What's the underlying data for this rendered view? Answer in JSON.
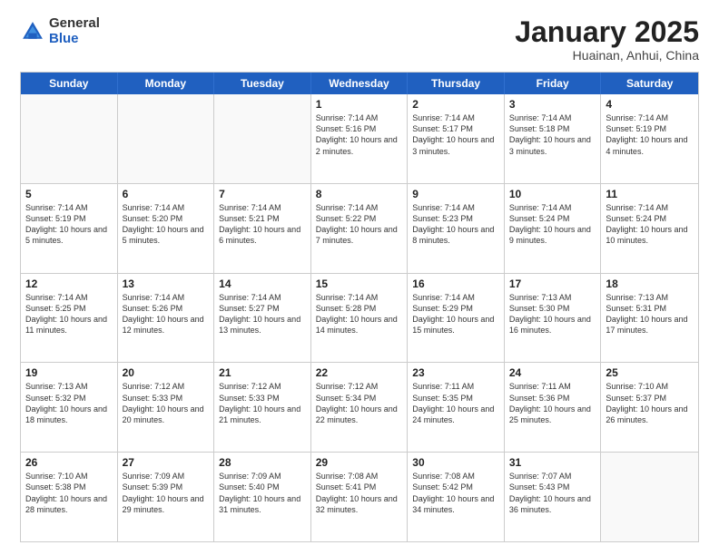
{
  "logo": {
    "general": "General",
    "blue": "Blue"
  },
  "title": "January 2025",
  "location": "Huainan, Anhui, China",
  "days_of_week": [
    "Sunday",
    "Monday",
    "Tuesday",
    "Wednesday",
    "Thursday",
    "Friday",
    "Saturday"
  ],
  "weeks": [
    [
      {
        "day": "",
        "sunrise": "",
        "sunset": "",
        "daylight": "",
        "empty": true
      },
      {
        "day": "",
        "sunrise": "",
        "sunset": "",
        "daylight": "",
        "empty": true
      },
      {
        "day": "",
        "sunrise": "",
        "sunset": "",
        "daylight": "",
        "empty": true
      },
      {
        "day": "1",
        "sunrise": "Sunrise: 7:14 AM",
        "sunset": "Sunset: 5:16 PM",
        "daylight": "Daylight: 10 hours and 2 minutes.",
        "empty": false
      },
      {
        "day": "2",
        "sunrise": "Sunrise: 7:14 AM",
        "sunset": "Sunset: 5:17 PM",
        "daylight": "Daylight: 10 hours and 3 minutes.",
        "empty": false
      },
      {
        "day": "3",
        "sunrise": "Sunrise: 7:14 AM",
        "sunset": "Sunset: 5:18 PM",
        "daylight": "Daylight: 10 hours and 3 minutes.",
        "empty": false
      },
      {
        "day": "4",
        "sunrise": "Sunrise: 7:14 AM",
        "sunset": "Sunset: 5:19 PM",
        "daylight": "Daylight: 10 hours and 4 minutes.",
        "empty": false
      }
    ],
    [
      {
        "day": "5",
        "sunrise": "Sunrise: 7:14 AM",
        "sunset": "Sunset: 5:19 PM",
        "daylight": "Daylight: 10 hours and 5 minutes.",
        "empty": false
      },
      {
        "day": "6",
        "sunrise": "Sunrise: 7:14 AM",
        "sunset": "Sunset: 5:20 PM",
        "daylight": "Daylight: 10 hours and 5 minutes.",
        "empty": false
      },
      {
        "day": "7",
        "sunrise": "Sunrise: 7:14 AM",
        "sunset": "Sunset: 5:21 PM",
        "daylight": "Daylight: 10 hours and 6 minutes.",
        "empty": false
      },
      {
        "day": "8",
        "sunrise": "Sunrise: 7:14 AM",
        "sunset": "Sunset: 5:22 PM",
        "daylight": "Daylight: 10 hours and 7 minutes.",
        "empty": false
      },
      {
        "day": "9",
        "sunrise": "Sunrise: 7:14 AM",
        "sunset": "Sunset: 5:23 PM",
        "daylight": "Daylight: 10 hours and 8 minutes.",
        "empty": false
      },
      {
        "day": "10",
        "sunrise": "Sunrise: 7:14 AM",
        "sunset": "Sunset: 5:24 PM",
        "daylight": "Daylight: 10 hours and 9 minutes.",
        "empty": false
      },
      {
        "day": "11",
        "sunrise": "Sunrise: 7:14 AM",
        "sunset": "Sunset: 5:24 PM",
        "daylight": "Daylight: 10 hours and 10 minutes.",
        "empty": false
      }
    ],
    [
      {
        "day": "12",
        "sunrise": "Sunrise: 7:14 AM",
        "sunset": "Sunset: 5:25 PM",
        "daylight": "Daylight: 10 hours and 11 minutes.",
        "empty": false
      },
      {
        "day": "13",
        "sunrise": "Sunrise: 7:14 AM",
        "sunset": "Sunset: 5:26 PM",
        "daylight": "Daylight: 10 hours and 12 minutes.",
        "empty": false
      },
      {
        "day": "14",
        "sunrise": "Sunrise: 7:14 AM",
        "sunset": "Sunset: 5:27 PM",
        "daylight": "Daylight: 10 hours and 13 minutes.",
        "empty": false
      },
      {
        "day": "15",
        "sunrise": "Sunrise: 7:14 AM",
        "sunset": "Sunset: 5:28 PM",
        "daylight": "Daylight: 10 hours and 14 minutes.",
        "empty": false
      },
      {
        "day": "16",
        "sunrise": "Sunrise: 7:14 AM",
        "sunset": "Sunset: 5:29 PM",
        "daylight": "Daylight: 10 hours and 15 minutes.",
        "empty": false
      },
      {
        "day": "17",
        "sunrise": "Sunrise: 7:13 AM",
        "sunset": "Sunset: 5:30 PM",
        "daylight": "Daylight: 10 hours and 16 minutes.",
        "empty": false
      },
      {
        "day": "18",
        "sunrise": "Sunrise: 7:13 AM",
        "sunset": "Sunset: 5:31 PM",
        "daylight": "Daylight: 10 hours and 17 minutes.",
        "empty": false
      }
    ],
    [
      {
        "day": "19",
        "sunrise": "Sunrise: 7:13 AM",
        "sunset": "Sunset: 5:32 PM",
        "daylight": "Daylight: 10 hours and 18 minutes.",
        "empty": false
      },
      {
        "day": "20",
        "sunrise": "Sunrise: 7:12 AM",
        "sunset": "Sunset: 5:33 PM",
        "daylight": "Daylight: 10 hours and 20 minutes.",
        "empty": false
      },
      {
        "day": "21",
        "sunrise": "Sunrise: 7:12 AM",
        "sunset": "Sunset: 5:33 PM",
        "daylight": "Daylight: 10 hours and 21 minutes.",
        "empty": false
      },
      {
        "day": "22",
        "sunrise": "Sunrise: 7:12 AM",
        "sunset": "Sunset: 5:34 PM",
        "daylight": "Daylight: 10 hours and 22 minutes.",
        "empty": false
      },
      {
        "day": "23",
        "sunrise": "Sunrise: 7:11 AM",
        "sunset": "Sunset: 5:35 PM",
        "daylight": "Daylight: 10 hours and 24 minutes.",
        "empty": false
      },
      {
        "day": "24",
        "sunrise": "Sunrise: 7:11 AM",
        "sunset": "Sunset: 5:36 PM",
        "daylight": "Daylight: 10 hours and 25 minutes.",
        "empty": false
      },
      {
        "day": "25",
        "sunrise": "Sunrise: 7:10 AM",
        "sunset": "Sunset: 5:37 PM",
        "daylight": "Daylight: 10 hours and 26 minutes.",
        "empty": false
      }
    ],
    [
      {
        "day": "26",
        "sunrise": "Sunrise: 7:10 AM",
        "sunset": "Sunset: 5:38 PM",
        "daylight": "Daylight: 10 hours and 28 minutes.",
        "empty": false
      },
      {
        "day": "27",
        "sunrise": "Sunrise: 7:09 AM",
        "sunset": "Sunset: 5:39 PM",
        "daylight": "Daylight: 10 hours and 29 minutes.",
        "empty": false
      },
      {
        "day": "28",
        "sunrise": "Sunrise: 7:09 AM",
        "sunset": "Sunset: 5:40 PM",
        "daylight": "Daylight: 10 hours and 31 minutes.",
        "empty": false
      },
      {
        "day": "29",
        "sunrise": "Sunrise: 7:08 AM",
        "sunset": "Sunset: 5:41 PM",
        "daylight": "Daylight: 10 hours and 32 minutes.",
        "empty": false
      },
      {
        "day": "30",
        "sunrise": "Sunrise: 7:08 AM",
        "sunset": "Sunset: 5:42 PM",
        "daylight": "Daylight: 10 hours and 34 minutes.",
        "empty": false
      },
      {
        "day": "31",
        "sunrise": "Sunrise: 7:07 AM",
        "sunset": "Sunset: 5:43 PM",
        "daylight": "Daylight: 10 hours and 36 minutes.",
        "empty": false
      },
      {
        "day": "",
        "sunrise": "",
        "sunset": "",
        "daylight": "",
        "empty": true
      }
    ]
  ]
}
